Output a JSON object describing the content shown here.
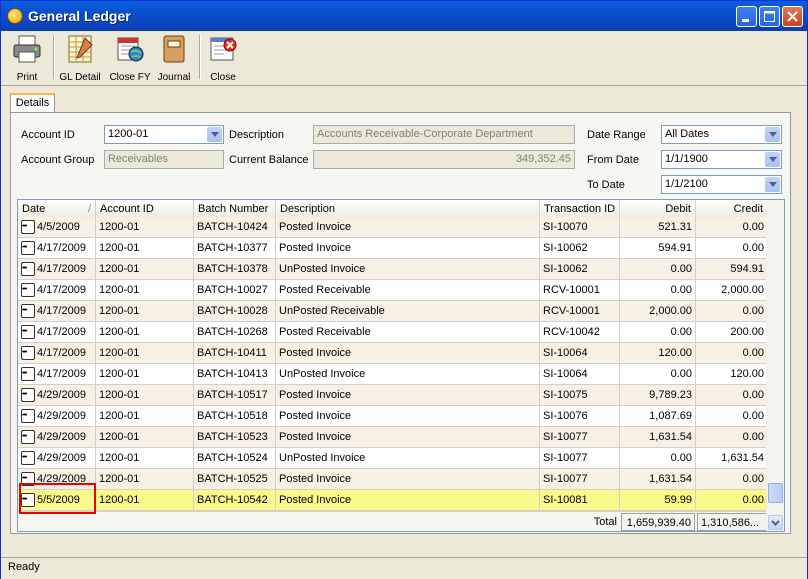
{
  "window": {
    "title": "General Ledger"
  },
  "toolbar": {
    "print": "Print",
    "gl_detail": "GL Detail",
    "close_fy": "Close FY",
    "journal": "Journal",
    "close": "Close"
  },
  "tabs": {
    "details": "Details"
  },
  "form": {
    "account_id_label": "Account ID",
    "account_id_value": "1200-01",
    "description_label": "Description",
    "description_value": "Accounts Receivable-Corporate Department",
    "account_group_label": "Account Group",
    "account_group_value": "Receivables",
    "current_balance_label": "Current Balance",
    "current_balance_value": "349,352.45",
    "date_range_label": "Date Range",
    "date_range_value": "All Dates",
    "from_date_label": "From Date",
    "from_date_value": "1/1/1900",
    "to_date_label": "To Date",
    "to_date_value": "1/1/2100"
  },
  "grid": {
    "columns": [
      "Date",
      "Account ID",
      "Batch Number",
      "Description",
      "Transaction ID",
      "Debit",
      "Credit"
    ],
    "sort_indicator": "/",
    "rows": [
      {
        "date": "4/5/2009",
        "account": "1200-01",
        "batch": "BATCH-10424",
        "desc": "Posted Invoice",
        "txn": "SI-10070",
        "debit": "521.31",
        "credit": "0.00"
      },
      {
        "date": "4/17/2009",
        "account": "1200-01",
        "batch": "BATCH-10377",
        "desc": "Posted Invoice",
        "txn": "SI-10062",
        "debit": "594.91",
        "credit": "0.00"
      },
      {
        "date": "4/17/2009",
        "account": "1200-01",
        "batch": "BATCH-10378",
        "desc": "UnPosted Invoice",
        "txn": "SI-10062",
        "debit": "0.00",
        "credit": "594.91"
      },
      {
        "date": "4/17/2009",
        "account": "1200-01",
        "batch": "BATCH-10027",
        "desc": "Posted Receivable",
        "txn": "RCV-10001",
        "debit": "0.00",
        "credit": "2,000.00"
      },
      {
        "date": "4/17/2009",
        "account": "1200-01",
        "batch": "BATCH-10028",
        "desc": "UnPosted Receivable",
        "txn": "RCV-10001",
        "debit": "2,000.00",
        "credit": "0.00"
      },
      {
        "date": "4/17/2009",
        "account": "1200-01",
        "batch": "BATCH-10268",
        "desc": "Posted Receivable",
        "txn": "RCV-10042",
        "debit": "0.00",
        "credit": "200.00"
      },
      {
        "date": "4/17/2009",
        "account": "1200-01",
        "batch": "BATCH-10411",
        "desc": "Posted Invoice",
        "txn": "SI-10064",
        "debit": "120.00",
        "credit": "0.00"
      },
      {
        "date": "4/17/2009",
        "account": "1200-01",
        "batch": "BATCH-10413",
        "desc": "UnPosted Invoice",
        "txn": "SI-10064",
        "debit": "0.00",
        "credit": "120.00"
      },
      {
        "date": "4/29/2009",
        "account": "1200-01",
        "batch": "BATCH-10517",
        "desc": "Posted Invoice",
        "txn": "SI-10075",
        "debit": "9,789.23",
        "credit": "0.00"
      },
      {
        "date": "4/29/2009",
        "account": "1200-01",
        "batch": "BATCH-10518",
        "desc": "Posted Invoice",
        "txn": "SI-10076",
        "debit": "1,087.69",
        "credit": "0.00"
      },
      {
        "date": "4/29/2009",
        "account": "1200-01",
        "batch": "BATCH-10523",
        "desc": "Posted Invoice",
        "txn": "SI-10077",
        "debit": "1,631.54",
        "credit": "0.00"
      },
      {
        "date": "4/29/2009",
        "account": "1200-01",
        "batch": "BATCH-10524",
        "desc": "UnPosted Invoice",
        "txn": "SI-10077",
        "debit": "0.00",
        "credit": "1,631.54"
      },
      {
        "date": "4/29/2009",
        "account": "1200-01",
        "batch": "BATCH-10525",
        "desc": "Posted Invoice",
        "txn": "SI-10077",
        "debit": "1,631.54",
        "credit": "0.00"
      },
      {
        "date": "5/5/2009",
        "account": "1200-01",
        "batch": "BATCH-10542",
        "desc": "Posted Invoice",
        "txn": "SI-10081",
        "debit": "59.99",
        "credit": "0.00"
      }
    ],
    "selected_index": 13,
    "total_label": "Total",
    "total_debit": "1,659,939.40",
    "total_credit": "1,310,586..."
  },
  "status": {
    "text": "Ready"
  },
  "colors": {
    "title_bar": "#0a4fd0",
    "row_even": "#f7f0e4",
    "row_odd": "#ffffff",
    "row_selected": "#fafa8c",
    "highlight_box": "#e00000"
  }
}
